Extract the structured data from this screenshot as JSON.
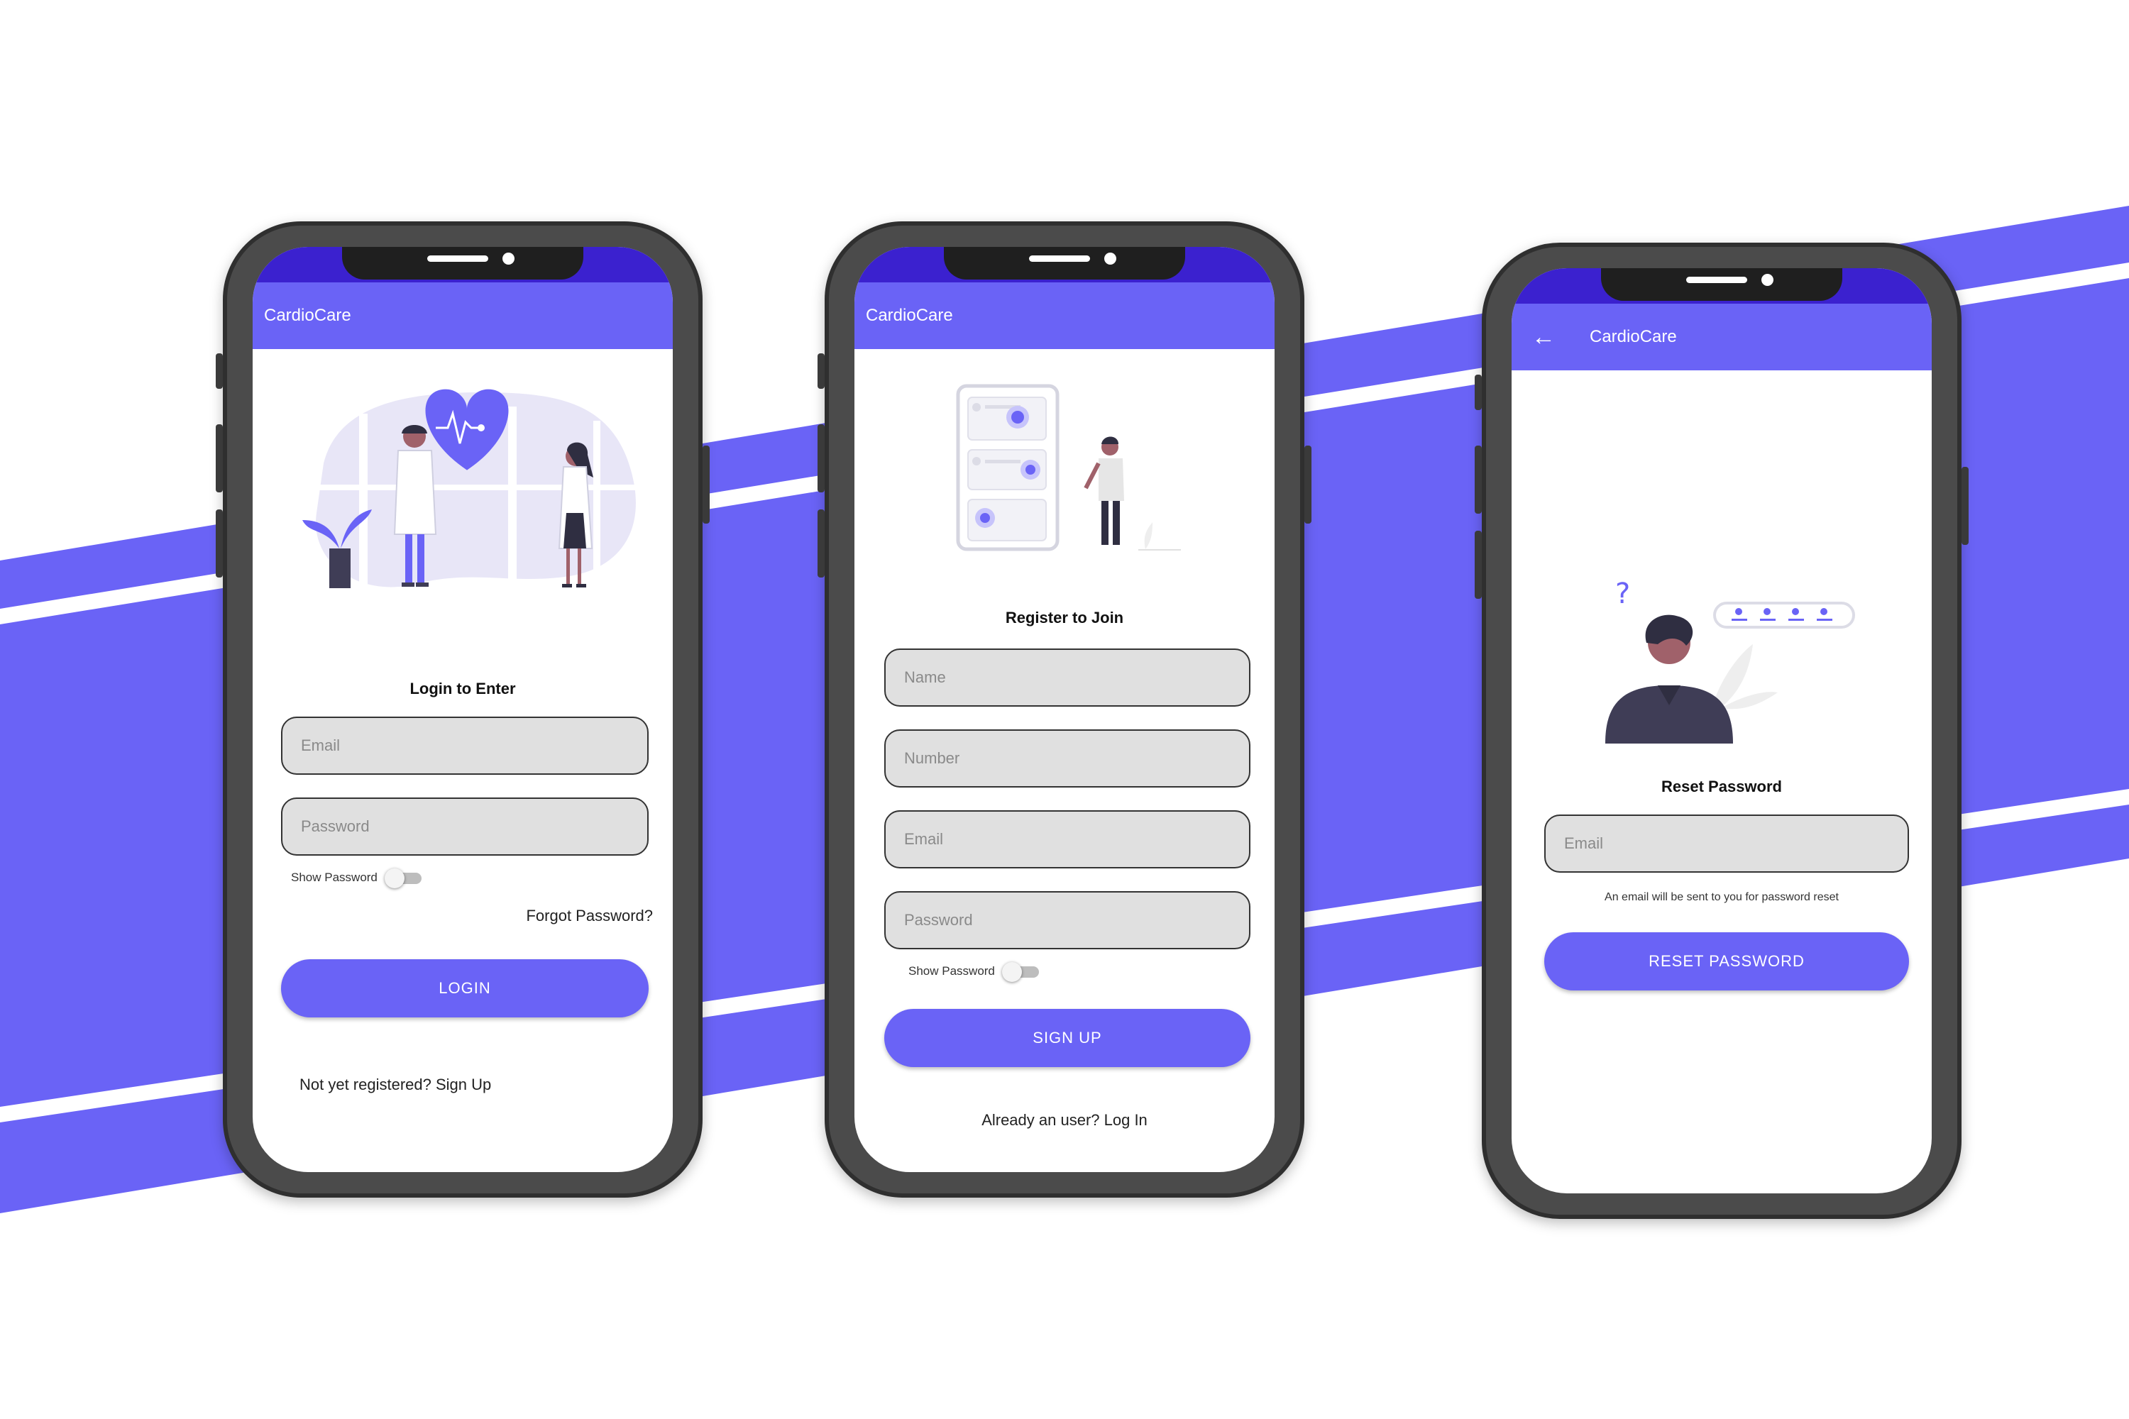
{
  "colors": {
    "accent": "#6a63f6",
    "status_bar": "#3b21cf",
    "field_bg": "#e0e0e0",
    "phone_frame": "#4b4b4b"
  },
  "login": {
    "app_title": "CardioCare",
    "heading": "Login to Enter",
    "email_placeholder": "Email",
    "password_placeholder": "Password",
    "show_password": "Show Password",
    "forgot_password": "Forgot Password?",
    "login_button": "LOGIN",
    "signup_prompt": "Not yet registered? Sign Up"
  },
  "register": {
    "app_title": "CardioCare",
    "heading": "Register to Join",
    "name_placeholder": "Name",
    "number_placeholder": "Number",
    "email_placeholder": "Email",
    "password_placeholder": "Password",
    "show_password": "Show Password",
    "signup_button": "SIGN UP",
    "login_prompt": "Already an user? Log In"
  },
  "reset": {
    "app_title": "CardioCare",
    "back_icon": "arrow-left-icon",
    "heading": "Reset Password",
    "email_placeholder": "Email",
    "helper_text": "An email will be sent to you for password reset",
    "reset_button": "RESET PASSWORD",
    "question_mark": "?"
  }
}
